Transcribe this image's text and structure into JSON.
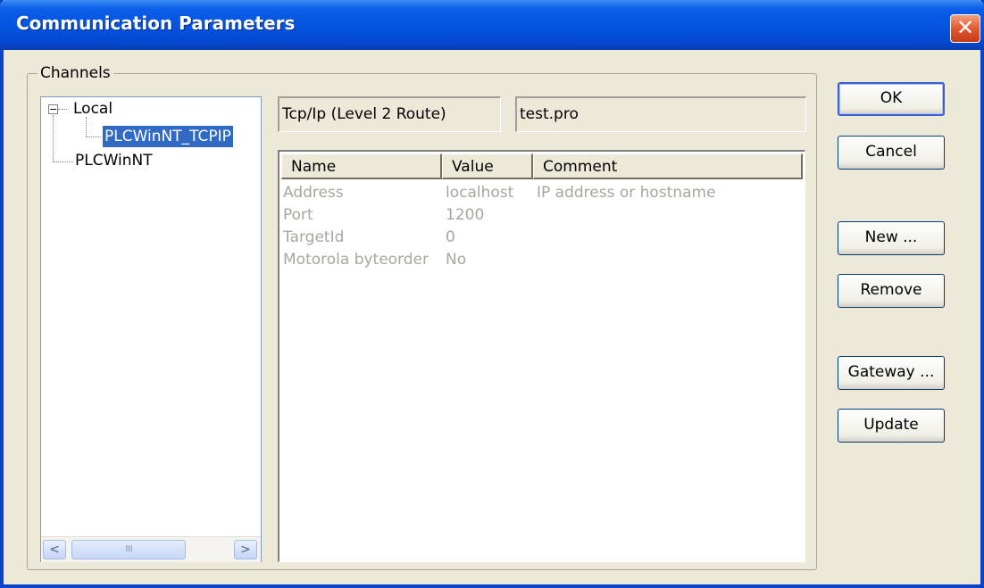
{
  "window": {
    "title": "Communication Parameters",
    "close_symbol": "✕"
  },
  "channels": {
    "group_label": "Channels",
    "tree": {
      "expander_symbol": "−",
      "nodes": [
        {
          "label": "Local",
          "expanded": true
        },
        {
          "label": "PLCWinNT_TCPIP",
          "selected": true
        },
        {
          "label": "PLCWinNT"
        }
      ]
    },
    "scrollbar": {
      "left_arrow": "<",
      "right_arrow": ">",
      "thumb_grip": "IIII"
    }
  },
  "info": {
    "driver": "Tcp/Ip (Level 2 Route)",
    "project": "test.pro"
  },
  "parameters": {
    "columns": [
      "Name",
      "Value",
      "Comment"
    ],
    "rows": [
      {
        "name": "Address",
        "value": "localhost",
        "comment": "IP address or hostname"
      },
      {
        "name": "Port",
        "value": "1200",
        "comment": ""
      },
      {
        "name": "TargetId",
        "value": "0",
        "comment": ""
      },
      {
        "name": "Motorola byteorder",
        "value": "No",
        "comment": ""
      }
    ]
  },
  "buttons": {
    "ok": "OK",
    "cancel": "Cancel",
    "new": "New ...",
    "remove": "Remove",
    "gateway": "Gateway ...",
    "update": "Update"
  },
  "colors": {
    "titlebar": "#0555e0",
    "selection": "#316ac5",
    "dialog_bg": "#ece9d8",
    "disabled_text": "#a7a6a0"
  }
}
